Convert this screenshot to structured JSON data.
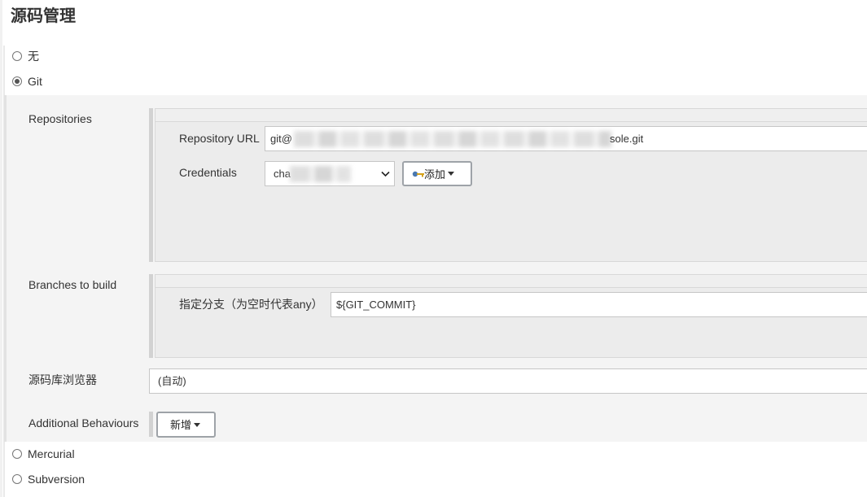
{
  "section": {
    "title": "源码管理"
  },
  "scm_options": [
    {
      "label": "无",
      "checked": false
    },
    {
      "label": "Git",
      "checked": true
    },
    {
      "label": "Mercurial",
      "checked": false
    },
    {
      "label": "Subversion",
      "checked": false
    }
  ],
  "git": {
    "repositories": {
      "label": "Repositories",
      "url_label": "Repository URL",
      "url_prefix": "git@",
      "url_suffix": "sole.git",
      "credentials_label": "Credentials",
      "credentials_value": "cha",
      "add_button": "添加",
      "add_button_icon": "key-icon"
    },
    "branches": {
      "label": "Branches to build",
      "branch_label": "指定分支（为空时代表any）",
      "branch_value": "${GIT_COMMIT}"
    },
    "browser": {
      "label": "源码库浏览器",
      "value": "(自动)"
    },
    "behaviours": {
      "label": "Additional Behaviours",
      "add_button": "新增"
    }
  },
  "colors": {
    "text": "#333333",
    "panel_bg": "#f4f4f4",
    "box_bg": "#ececec",
    "button_border": "#9ea3a8"
  }
}
